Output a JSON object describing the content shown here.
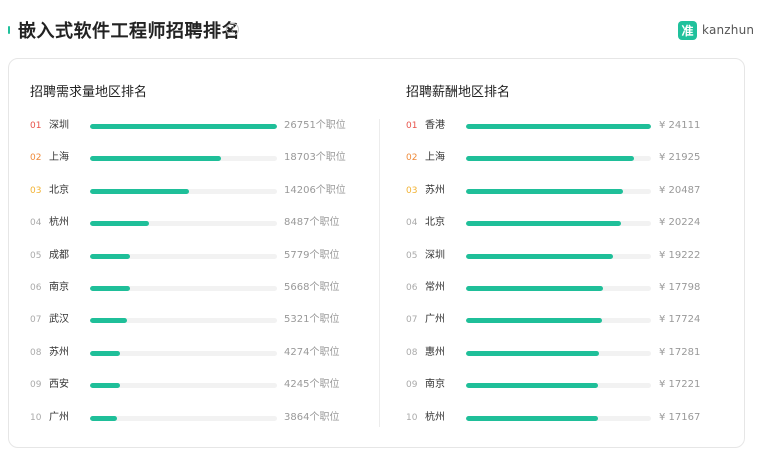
{
  "header": {
    "title": "嵌入式软件工程师招聘排名",
    "help_icon": "?",
    "logo_mark": "准",
    "logo_text": "kanzhun"
  },
  "colors": {
    "accent": "#20c19c",
    "bar": "#1fbf99",
    "track": "#f2f2f2",
    "rank_top1": "#e8534b",
    "rank_top2": "#ef8a3a",
    "rank_top3": "#f2b233",
    "rank_other": "#aaaaaa"
  },
  "jobs_panel": {
    "title": "招聘需求量地区排名",
    "items": [
      {
        "rank": "01",
        "city": "深圳",
        "value": 26751,
        "label": "26751个职位"
      },
      {
        "rank": "02",
        "city": "上海",
        "value": 18703,
        "label": "18703个职位"
      },
      {
        "rank": "03",
        "city": "北京",
        "value": 14206,
        "label": "14206个职位"
      },
      {
        "rank": "04",
        "city": "杭州",
        "value": 8487,
        "label": "8487个职位"
      },
      {
        "rank": "05",
        "city": "成都",
        "value": 5779,
        "label": "5779个职位"
      },
      {
        "rank": "06",
        "city": "南京",
        "value": 5668,
        "label": "5668个职位"
      },
      {
        "rank": "07",
        "city": "武汉",
        "value": 5321,
        "label": "5321个职位"
      },
      {
        "rank": "08",
        "city": "苏州",
        "value": 4274,
        "label": "4274个职位"
      },
      {
        "rank": "09",
        "city": "西安",
        "value": 4245,
        "label": "4245个职位"
      },
      {
        "rank": "10",
        "city": "广州",
        "value": 3864,
        "label": "3864个职位"
      }
    ]
  },
  "salary_panel": {
    "title": "招聘薪酬地区排名",
    "items": [
      {
        "rank": "01",
        "city": "香港",
        "value": 24111,
        "label": "¥ 24111"
      },
      {
        "rank": "02",
        "city": "上海",
        "value": 21925,
        "label": "¥ 21925"
      },
      {
        "rank": "03",
        "city": "苏州",
        "value": 20487,
        "label": "¥ 20487"
      },
      {
        "rank": "04",
        "city": "北京",
        "value": 20224,
        "label": "¥ 20224"
      },
      {
        "rank": "05",
        "city": "深圳",
        "value": 19222,
        "label": "¥ 19222"
      },
      {
        "rank": "06",
        "city": "常州",
        "value": 17798,
        "label": "¥ 17798"
      },
      {
        "rank": "07",
        "city": "广州",
        "value": 17724,
        "label": "¥ 17724"
      },
      {
        "rank": "08",
        "city": "惠州",
        "value": 17281,
        "label": "¥ 17281"
      },
      {
        "rank": "09",
        "city": "南京",
        "value": 17221,
        "label": "¥ 17221"
      },
      {
        "rank": "10",
        "city": "杭州",
        "value": 17167,
        "label": "¥ 17167"
      }
    ]
  }
}
